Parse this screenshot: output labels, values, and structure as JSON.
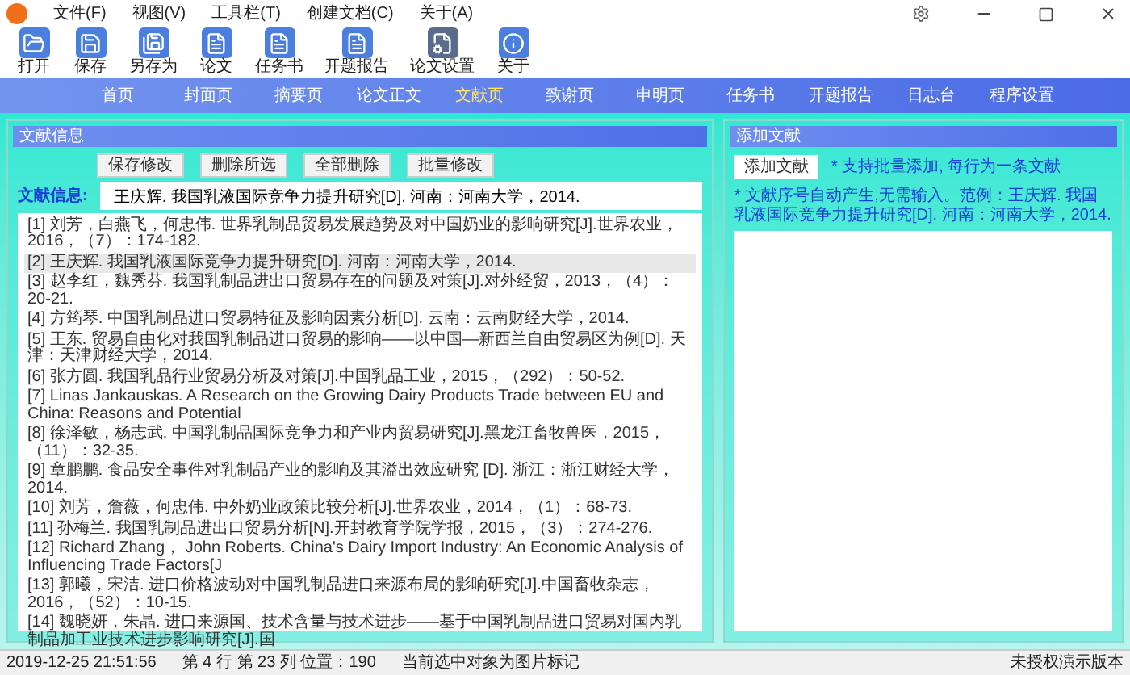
{
  "window": {
    "menu": [
      "文件(F)",
      "视图(V)",
      "工具栏(T)",
      "创建文档(C)",
      "关于(A)"
    ]
  },
  "toolbar": [
    {
      "label": "打开",
      "kind": "open"
    },
    {
      "label": "保存",
      "kind": "save"
    },
    {
      "label": "另存为",
      "kind": "saveas"
    },
    {
      "label": "论文",
      "kind": "doc"
    },
    {
      "label": "任务书",
      "kind": "doc"
    },
    {
      "label": "开题报告",
      "kind": "doc"
    },
    {
      "label": "论文设置",
      "kind": "settings"
    },
    {
      "label": "关于",
      "kind": "info"
    }
  ],
  "nav": [
    {
      "label": "首页",
      "selected": false
    },
    {
      "label": "封面页",
      "selected": false
    },
    {
      "label": "摘要页",
      "selected": false
    },
    {
      "label": "论文正文",
      "selected": false
    },
    {
      "label": "文献页",
      "selected": true
    },
    {
      "label": "致谢页",
      "selected": false
    },
    {
      "label": "申明页",
      "selected": false
    },
    {
      "label": "任务书",
      "selected": false
    },
    {
      "label": "开题报告",
      "selected": false
    },
    {
      "label": "日志台",
      "selected": false
    },
    {
      "label": "程序设置",
      "selected": false
    }
  ],
  "left_panel": {
    "title": "文献信息",
    "buttons": [
      "保存修改",
      "删除所选",
      "全部删除",
      "批量修改"
    ],
    "info_label": "文献信息:",
    "info_value": "王庆辉. 我国乳液国际竞争力提升研究[D]. 河南：河南大学，2014.",
    "references": [
      {
        "text": "[1] 刘芳，白燕飞，何忠伟. 世界乳制品贸易发展趋势及对中国奶业的影响研究[J].世界农业，2016，（7）：174-182.",
        "selected": false
      },
      {
        "text": "[2] 王庆辉. 我国乳液国际竞争力提升研究[D]. 河南：河南大学，2014.",
        "selected": true
      },
      {
        "text": "[3] 赵李红，魏秀芬. 我国乳制品进出口贸易存在的问题及对策[J].对外经贸，2013，（4）：20-21.",
        "selected": false
      },
      {
        "text": "[4] 方筠琴. 中国乳制品进口贸易特征及影响因素分析[D]. 云南：云南财经大学，2014.",
        "selected": false
      },
      {
        "text": "[5] 王东. 贸易自由化对我国乳制品进口贸易的影响——以中国—新西兰自由贸易区为例[D]. 天津：天津财经大学，2014.",
        "selected": false
      },
      {
        "text": "[6] 张方圆. 我国乳品行业贸易分析及对策[J].中国乳品工业，2015，（292）：50-52.",
        "selected": false
      },
      {
        "text": "[7] Linas Jankauskas. A Research on the Growing Dairy Products Trade between EU and China: Reasons and Potential",
        "selected": false
      },
      {
        "text": "[8] 徐泽敏，杨志武. 中国乳制品国际竞争力和产业内贸易研究[J].黑龙江畜牧兽医，2015，（11）：32-35.",
        "selected": false
      },
      {
        "text": "[9] 章鹏鹏. 食品安全事件对乳制品产业的影响及其溢出效应研究 [D]. 浙江：浙江财经大学，2014.",
        "selected": false
      },
      {
        "text": "[10] 刘芳，詹薇，何忠伟. 中外奶业政策比较分析[J].世界农业，2014，（1）：68-73.",
        "selected": false
      },
      {
        "text": "[11] 孙梅兰. 我国乳制品进出口贸易分析[N].开封教育学院学报，2015，（3）：274-276.",
        "selected": false
      },
      {
        "text": "[12] Richard Zhang， John Roberts. China's Dairy Import Industry: An Economic Analysis of Influencing Trade Factors[J",
        "selected": false
      },
      {
        "text": "[13] 郭曦，宋洁. 进口价格波动对中国乳制品进口来源布局的影响研究[J].中国畜牧杂志，2016，（52）：10-15.",
        "selected": false
      },
      {
        "text": "[14] 魏晓妍，朱晶. 进口来源国、技术含量与技术进步——基于中国乳制品进口贸易对国内乳制品加工业技术进步影响研究[J].国",
        "selected": false
      }
    ]
  },
  "right_panel": {
    "title": "添加文献",
    "button": "添加文献",
    "hint": "* 支持批量添加, 每行为一条文献",
    "example": "* 文献序号自动产生,无需输入。范例：王庆辉. 我国乳液国际竞争力提升研究[D]. 河南：河南大学，2014."
  },
  "status_bar": {
    "time": "2019-12-25 21:51:56",
    "position": "第 4 行 第 23 列 位置：190",
    "message": "当前选中对象为图片标记",
    "license": "未授权演示版本"
  }
}
